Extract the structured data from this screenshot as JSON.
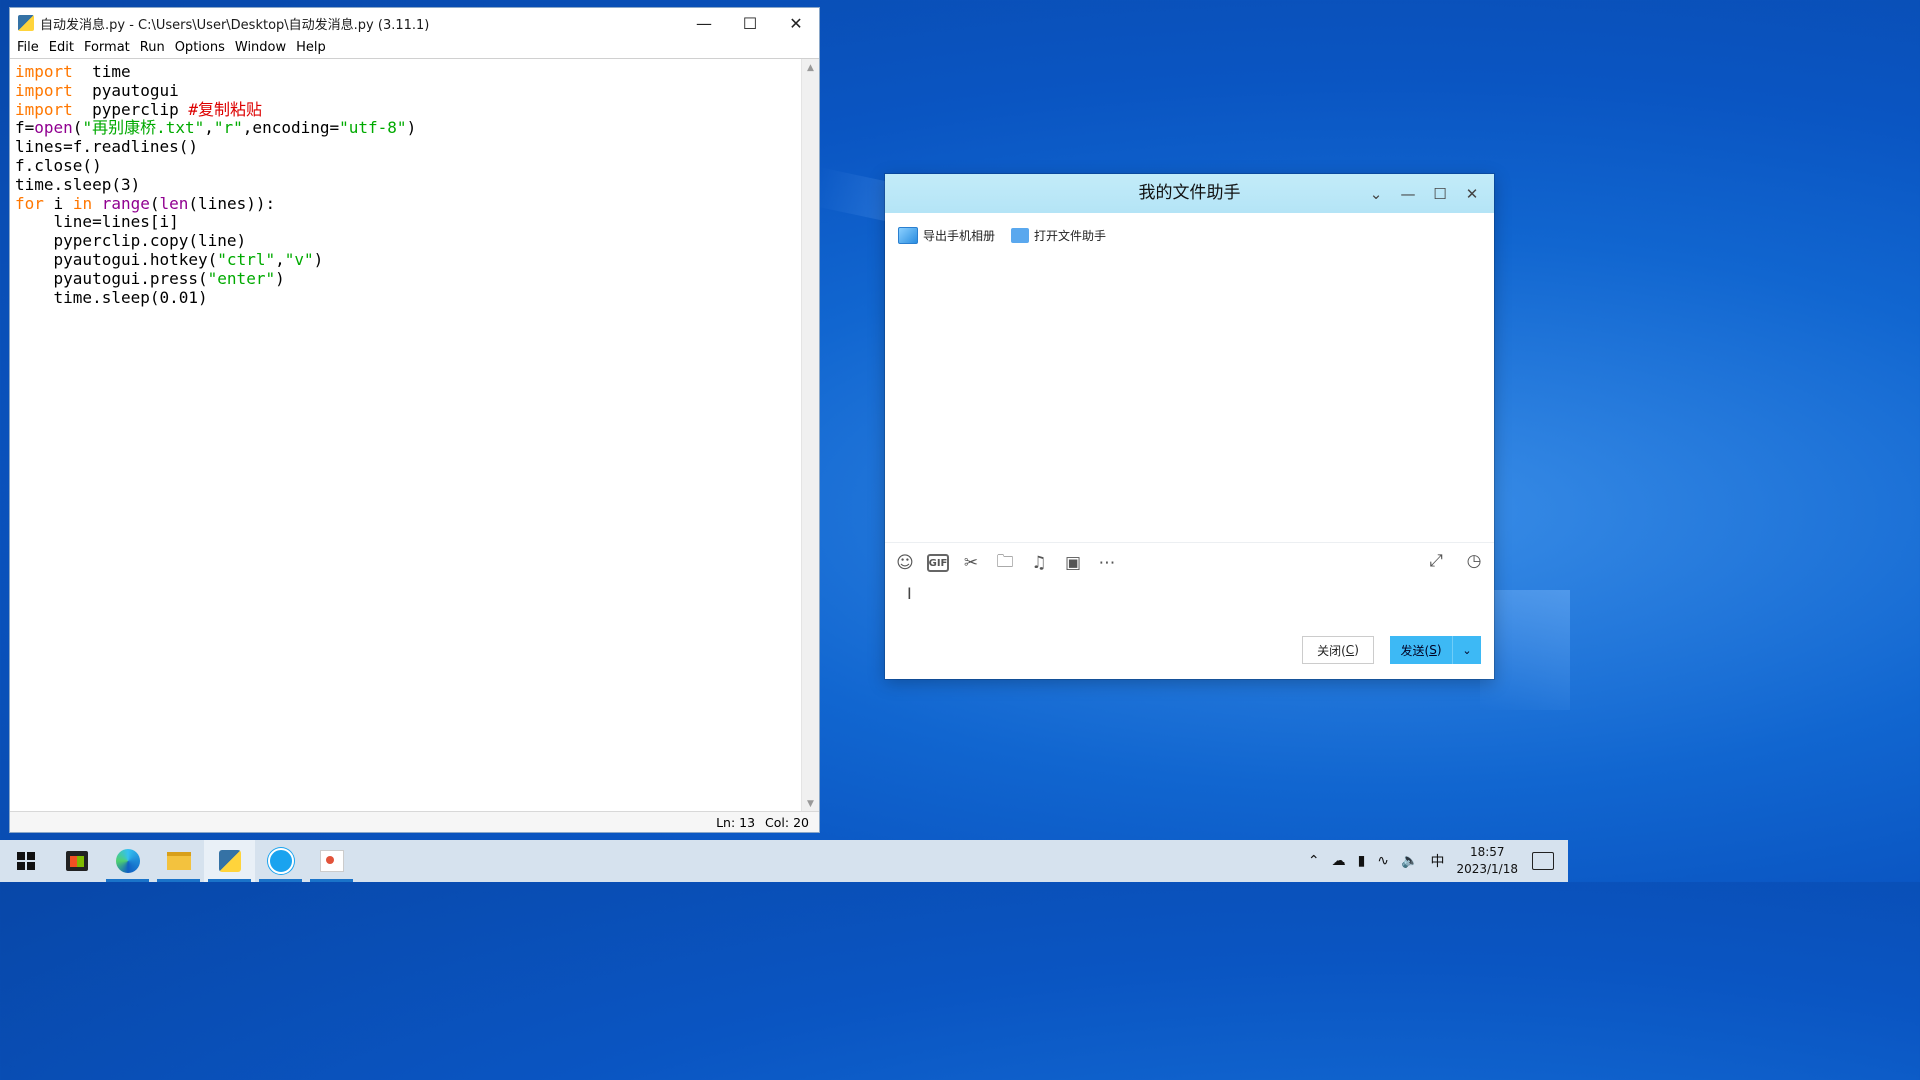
{
  "idle": {
    "title": "自动发消息.py - C:\\Users\\User\\Desktop\\自动发消息.py (3.11.1)",
    "menu": [
      "File",
      "Edit",
      "Format",
      "Run",
      "Options",
      "Window",
      "Help"
    ],
    "status_ln": "Ln: 13",
    "status_col": "Col: 20",
    "code": [
      [
        [
          "kw",
          "import"
        ],
        [
          "",
          "  time"
        ]
      ],
      [
        [
          "kw",
          "import"
        ],
        [
          "",
          "  pyautogui"
        ]
      ],
      [
        [
          "kw",
          "import"
        ],
        [
          "",
          "  pyperclip "
        ],
        [
          "cm",
          "#复制粘贴"
        ]
      ],
      [
        [
          "",
          "f="
        ],
        [
          "bi",
          "open"
        ],
        [
          "",
          "("
        ],
        [
          "st",
          "\"再别康桥.txt\""
        ],
        [
          "",
          ","
        ],
        [
          "st",
          "\"r\""
        ],
        [
          "",
          ",encoding="
        ],
        [
          "st",
          "\"utf-8\""
        ],
        [
          "",
          ")"
        ]
      ],
      [
        [
          "",
          "lines=f.readlines()"
        ]
      ],
      [
        [
          "",
          "f.close()"
        ]
      ],
      [
        [
          "",
          "time.sleep(3)"
        ]
      ],
      [
        [
          "kw",
          "for"
        ],
        [
          "",
          " i "
        ],
        [
          "kw",
          "in"
        ],
        [
          "",
          ""
        ],
        [
          "bi",
          " range"
        ],
        [
          "",
          "("
        ],
        [
          "bi",
          "len"
        ],
        [
          "",
          "(lines)):"
        ]
      ],
      [
        [
          "",
          "    line=lines[i]"
        ]
      ],
      [
        [
          "",
          "    pyperclip.copy(line)"
        ]
      ],
      [
        [
          "",
          "    pyautogui.hotkey("
        ],
        [
          "st",
          "\"ctrl\""
        ],
        [
          "",
          ","
        ],
        [
          "st",
          "\"v\""
        ],
        [
          "",
          ")"
        ]
      ],
      [
        [
          "",
          "    pyautogui.press("
        ],
        [
          "st",
          "\"enter\""
        ],
        [
          "",
          ")"
        ]
      ],
      [
        [
          "",
          "    time.sleep(0.01)"
        ]
      ]
    ]
  },
  "qq": {
    "title": "我的文件助手",
    "export_photos": "导出手机相册",
    "open_helper": "打开文件助手",
    "close_label": "关闭(",
    "close_key": "C",
    "send_label": "发送(",
    "send_key": "S",
    "paren_close": ")"
  },
  "taskbar": {
    "time": "18:57",
    "date": "2023/1/18",
    "ime": "中"
  }
}
